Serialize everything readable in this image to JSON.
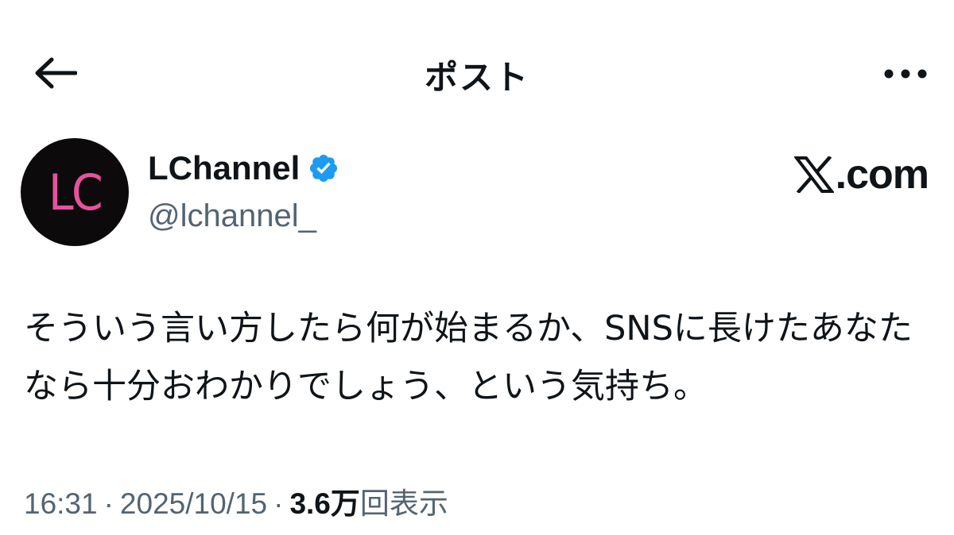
{
  "header": {
    "title": "ポスト",
    "back_icon": "arrow-left-icon",
    "more_icon": "more-horizontal-icon"
  },
  "author": {
    "avatar_initials": "LC",
    "display_name": "LChannel",
    "handle": "@lchannel_",
    "verified": true,
    "verified_color": "#1d9bf0",
    "avatar_bg": "#0c0a0b",
    "avatar_fg": "#e6529d"
  },
  "watermark": {
    "text": ".com",
    "logo_icon": "x-logo-icon"
  },
  "post": {
    "text": "そういう言い方したら何が始まるか、SNSに長けたあなたなら十分おわかりでしょう、という気持ち。"
  },
  "meta": {
    "time": "16:31",
    "separator": "·",
    "date": "2025/10/15",
    "views_count": "3.6万",
    "views_label": "回表示"
  },
  "colors": {
    "text_primary": "#0f1419",
    "text_secondary": "#536471",
    "background": "#ffffff"
  }
}
